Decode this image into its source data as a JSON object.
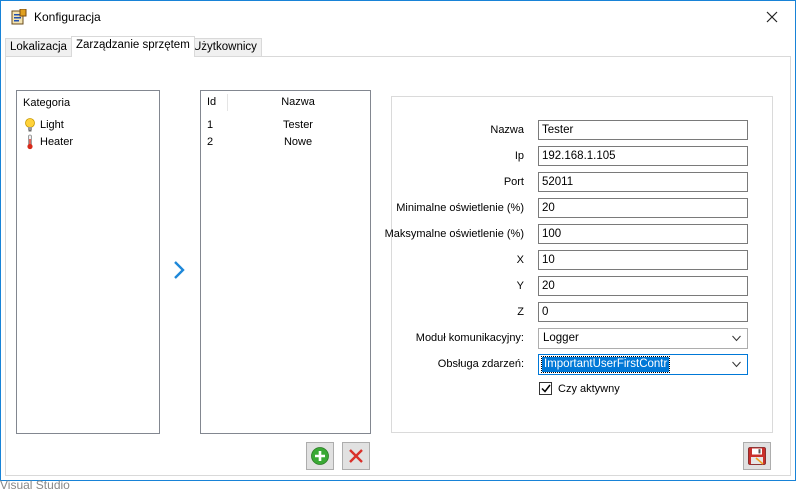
{
  "window": {
    "title": "Konfiguracja",
    "close_symbol": "✕"
  },
  "tabs": [
    {
      "label": "Lokalizacja",
      "active": false
    },
    {
      "label": "Zarządzanie sprzętem",
      "active": true
    },
    {
      "label": "Użytkownicy",
      "active": false
    }
  ],
  "category_list": {
    "header": "Kategoria",
    "items": [
      {
        "label": "Light",
        "icon": "lightbulb-icon"
      },
      {
        "label": "Heater",
        "icon": "thermometer-icon"
      }
    ]
  },
  "device_grid": {
    "columns": [
      "Id",
      "Nazwa"
    ],
    "rows": [
      {
        "id": "1",
        "name": "Tester"
      },
      {
        "id": "2",
        "name": "Nowe"
      }
    ]
  },
  "form": {
    "nazwa": {
      "label": "Nazwa",
      "value": "Tester"
    },
    "ip": {
      "label": "Ip",
      "value": "192.168.1.105"
    },
    "port": {
      "label": "Port",
      "value": "52011"
    },
    "min_light": {
      "label": "Minimalne oświetlenie (%)",
      "value": "20"
    },
    "max_light": {
      "label": "Maksymalne oświetlenie (%)",
      "value": "100"
    },
    "x": {
      "label": "X",
      "value": "10"
    },
    "y": {
      "label": "Y",
      "value": "20"
    },
    "z": {
      "label": "Z",
      "value": "0"
    },
    "comm_module": {
      "label": "Moduł komunikacyjny:",
      "value": "Logger"
    },
    "event_handler": {
      "label": "Obsługa zdarzeń:",
      "value": "ImportantUserFirstContr"
    },
    "active": {
      "label": "Czy aktywny",
      "checked": true
    }
  },
  "background_text": "Visual Studio",
  "colors": {
    "accent": "#0078d7",
    "window_border": "#1883d7",
    "add_green": "#3aa935",
    "delete_red": "#d9302a"
  }
}
